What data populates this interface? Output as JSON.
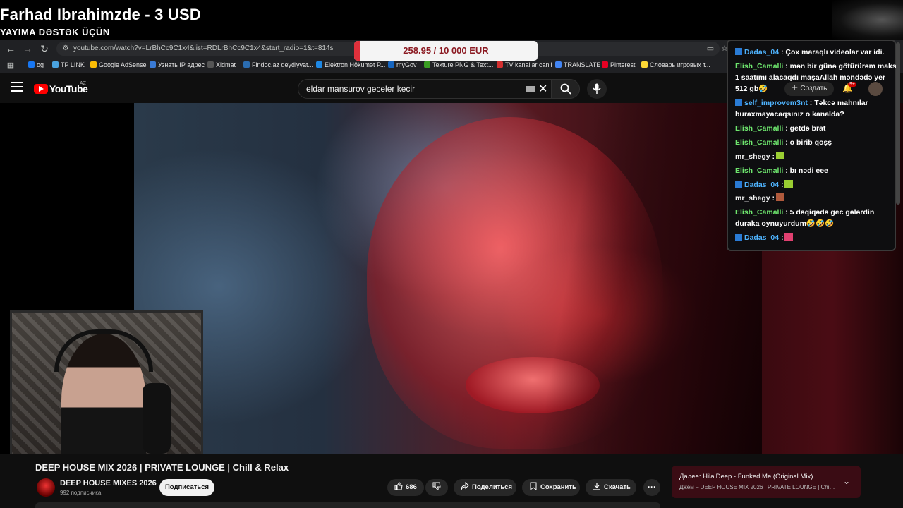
{
  "donation": {
    "title": "Farhad Ibrahimzde - 3 USD",
    "subtitle": "YAYIMA DƏSTƏK ÜÇÜN"
  },
  "goal": {
    "text": "258.95 / 10 000 EUR",
    "progress_fraction": 0.026,
    "fill_color": "#e0303b"
  },
  "browser": {
    "url": "youtube.com/watch?v=LrBhCc9C1x4&list=RDLrBhCc9C1x4&start_radio=1&t=814s",
    "bookmarks": [
      {
        "label": "og",
        "color": "#1877f2"
      },
      {
        "label": "TP LINK",
        "color": "#4aa3df"
      },
      {
        "label": "Google AdSense",
        "color": "#fbbc05"
      },
      {
        "label": "Узнать IP адрес",
        "color": "#3a7bd5"
      },
      {
        "label": "Xidmat",
        "color": "#555"
      },
      {
        "label": "Findoc.az qeydiyyat...",
        "color": "#2b6cb0"
      },
      {
        "label": "Elektron Hökumət P...",
        "color": "#1e88e5"
      },
      {
        "label": "myGov",
        "color": "#1565c0"
      },
      {
        "label": "Texture PNG & Text...",
        "color": "#3a9d23"
      },
      {
        "label": "TV kanallar canli",
        "color": "#d32f2f"
      },
      {
        "label": "TRANSLATE",
        "color": "#4285f4"
      },
      {
        "label": "Pinterest",
        "color": "#e60023"
      },
      {
        "label": "Словарь игровых т...",
        "color": "#fdd835"
      }
    ]
  },
  "youtube": {
    "logo_text": "YouTube",
    "region": "AZ",
    "search_value": "eldar mansurov geceler kecir",
    "create_label": "Создать",
    "notifications_badge": "9+"
  },
  "chat": {
    "messages": [
      {
        "user": "Dadas_04",
        "badge": true,
        "color": "blue",
        "text": ": Çox maraqlı videolar var idi."
      },
      {
        "user": "Elish_Camalli",
        "badge": false,
        "color": "green",
        "text": ": mən bir günə götürürəm maks"
      },
      {
        "user": "",
        "badge": false,
        "color": "gray",
        "text": "1 saatımı alacaqdı maşaAllah məndədə yer"
      },
      {
        "user": "",
        "badge": false,
        "color": "gray",
        "text": "512 gb🤣"
      },
      {
        "user": "self_improvem3nt",
        "badge": true,
        "color": "blue",
        "text": ": Təkcə mahnılar"
      },
      {
        "user": "",
        "badge": false,
        "color": "gray",
        "text": "buraxmayacaqsınız o kanalda?"
      },
      {
        "user": "Elish_Camalli",
        "badge": false,
        "color": "green",
        "text": ": getdə brat"
      },
      {
        "user": "Elish_Camalli",
        "badge": false,
        "color": "green",
        "text": ": o birib qoşş"
      },
      {
        "user": "mr_shegy",
        "badge": false,
        "color": "gray",
        "text": ":",
        "emote": "#9acd32"
      },
      {
        "user": "Elish_Camalli",
        "badge": false,
        "color": "green",
        "text": ": bı nədi eee"
      },
      {
        "user": "Dadas_04",
        "badge": true,
        "color": "blue",
        "text": ":",
        "emote": "#9acd32"
      },
      {
        "user": "mr_shegy",
        "badge": false,
        "color": "gray",
        "text": ":",
        "emote": "#b05a3c"
      },
      {
        "user": "Elish_Camalli",
        "badge": false,
        "color": "green",
        "text": ": 5 dəqiqədə gec gələrdin"
      },
      {
        "user": "",
        "badge": false,
        "color": "gray",
        "text": "duraka oynuyurdum🤣🤣🤣"
      },
      {
        "user": "Dadas_04",
        "badge": true,
        "color": "blue",
        "text": ":",
        "emote": "#e04070"
      }
    ]
  },
  "video": {
    "title": "DEEP HOUSE MIX 2026 | PRIVATE LOUNGE | Chill & Relax",
    "channel": "DEEP HOUSE MIXES 2026",
    "subscribers": "992 подписчика",
    "subscribe_label": "Подписаться",
    "likes": "686",
    "share_label": "Поделиться",
    "save_label": "Сохранить",
    "download_label": "Скачать",
    "more_label": "···"
  },
  "next_up": {
    "title": "Далее: HilalDeep - Funked Me (Original Mix)",
    "subtitle": "Джем – DEEP HOUSE MIX 2026 | PRIVATE LOUNGE | Chill & ..."
  }
}
